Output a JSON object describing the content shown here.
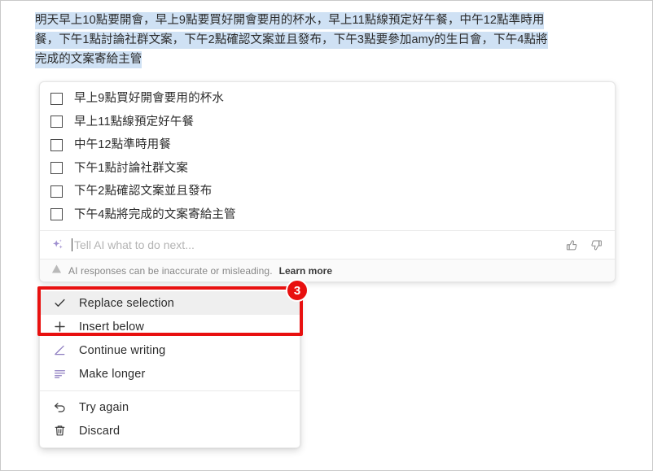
{
  "document": {
    "selected_paragraph_lines": [
      "明天早上10點要開會，早上9點要買好開會要用的杯水，早上11點線預定好午餐，中午12點準時用",
      "餐，下午1點討論社群文案，下午2點確認文案並且發布，下午3點要參加amy的生日會，下午4點將",
      "完成的文案寄給主管"
    ],
    "selection_highlight_color": "#cfe1f4"
  },
  "ai_card": {
    "todo_items": [
      {
        "label": "早上9點買好開會要用的杯水",
        "checked": false
      },
      {
        "label": "早上11點線預定好午餐",
        "checked": false
      },
      {
        "label": "中午12點準時用餐",
        "checked": false
      },
      {
        "label": "下午1點討論社群文案",
        "checked": false
      },
      {
        "label": "下午2點確認文案並且發布",
        "checked": false
      },
      {
        "label": "下午4點將完成的文案寄給主管",
        "checked": false
      }
    ],
    "prompt": {
      "icon": "sparkle-icon",
      "value": "",
      "placeholder": "Tell AI what to do next...",
      "thumbs_up_icon": "thumbs-up-icon",
      "thumbs_down_icon": "thumbs-down-icon"
    },
    "disclaimer": {
      "icon": "warning-icon",
      "text": "AI responses can be inaccurate or misleading.",
      "link_label": "Learn more"
    }
  },
  "context_menu": {
    "groups": [
      {
        "items": [
          {
            "label": "Replace selection",
            "icon": "check-icon",
            "selected": true
          },
          {
            "label": "Insert below",
            "icon": "plus-icon",
            "selected": false
          },
          {
            "label": "Continue writing",
            "icon": "pencil-icon",
            "selected": false
          },
          {
            "label": "Make longer",
            "icon": "lines-icon",
            "selected": false
          }
        ]
      },
      {
        "items": [
          {
            "label": "Try again",
            "icon": "undo-icon",
            "selected": false
          },
          {
            "label": "Discard",
            "icon": "trash-icon",
            "selected": false
          }
        ]
      }
    ]
  },
  "annotation": {
    "badge_number": "3",
    "color": "#e8100f"
  }
}
